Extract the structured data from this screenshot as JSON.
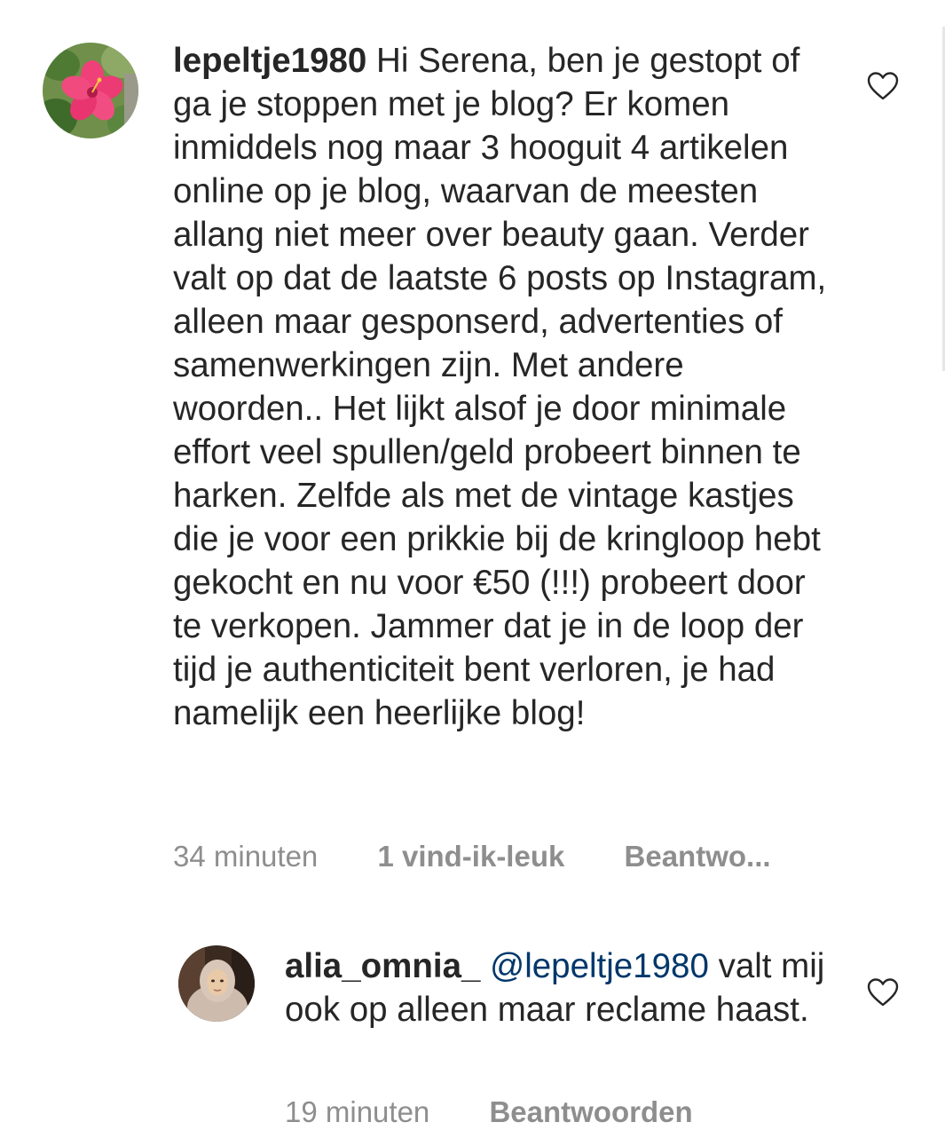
{
  "comments": [
    {
      "username": "lepeltje1980",
      "text": "Hi Serena, ben je gestopt of ga je stoppen met je blog? Er komen inmiddels nog maar 3 hooguit 4 artikelen online op je blog, waarvan de meesten allang niet meer over beauty gaan. Verder valt op dat de laatste 6 posts op Instagram, alleen maar gesponserd, advertenties of samenwerkingen zijn. Met andere woorden.. Het lijkt alsof je door minimale effort veel spullen/geld probeert binnen te harken. Zelfde als met de vintage kastjes die je voor een prikkie bij de kringloop hebt gekocht en nu voor €50 (!!!) probeert door te verkopen. Jammer dat je in de loop der tijd je authenticiteit bent verloren, je had namelijk een heerlijke blog!",
      "time": "34 minuten",
      "likes": "1 vind-ik-leuk",
      "reply_label": "Beantwo...",
      "avatar_icon": "hibiscus-flower-photo",
      "like_icon": "heart-outline-icon"
    },
    {
      "username": "alia_omnia_",
      "mention": "@lepeltje1980",
      "text": "valt mij ook op alleen maar reclame haast.",
      "time": "19 minuten",
      "reply_label": "Beantwoorden",
      "avatar_icon": "profile-photo",
      "like_icon": "heart-outline-icon"
    }
  ],
  "colors": {
    "text": "#262626",
    "meta": "#8e8e8e",
    "mention": "#00376b",
    "background": "#ffffff"
  }
}
